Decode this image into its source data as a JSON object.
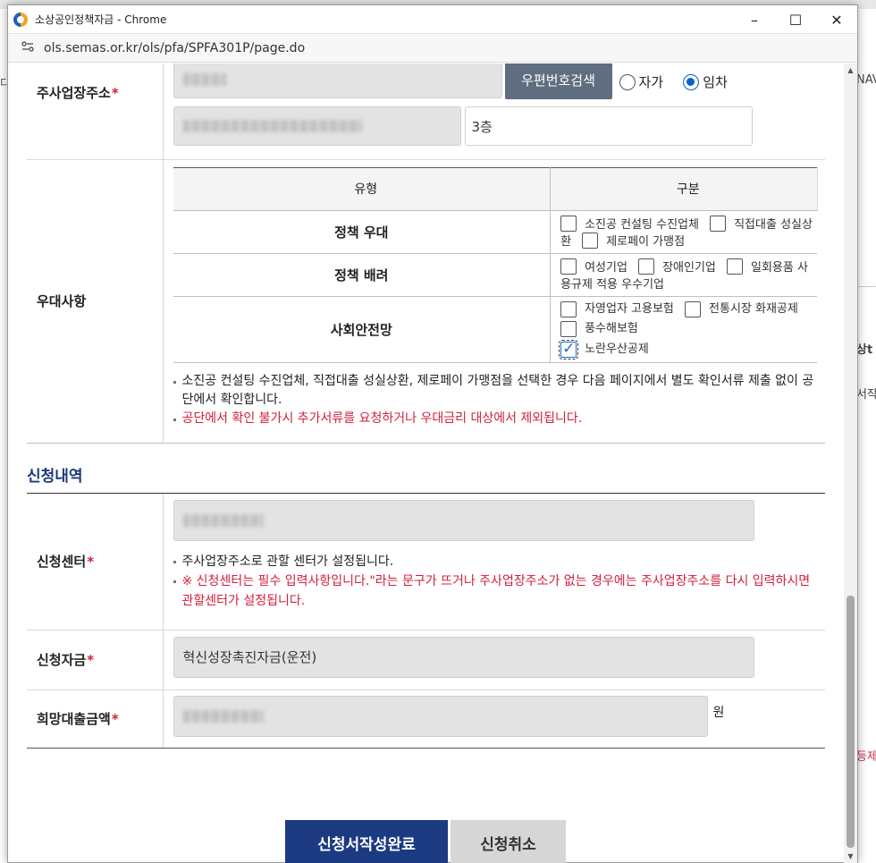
{
  "window": {
    "title": "소상공인정책자금 - Chrome",
    "url": "ols.semas.or.kr/ols/pfa/SPFA301P/page.do",
    "controls": {
      "minimize": "–",
      "maximize": "☐",
      "close": "✕"
    }
  },
  "background": {
    "left_text": "디",
    "right_texts": [
      "NAV",
      "상t",
      "서작",
      "등제"
    ]
  },
  "address": {
    "label": "주사업장주소",
    "required_mark": "*",
    "search_button": "우편번호검색",
    "ownership_options": [
      {
        "label": "자가",
        "selected": false
      },
      {
        "label": "임차",
        "selected": true
      }
    ],
    "detail_value": "3층"
  },
  "preferences": {
    "label": "우대사항",
    "header_type": "유형",
    "header_category": "구분",
    "rows": [
      {
        "name": "정책 우대",
        "options": [
          {
            "label": "소진공 컨설팅 수진업체",
            "checked": false
          },
          {
            "label": "직접대출 성실상환",
            "checked": false
          },
          {
            "label": "제로페이 가맹점",
            "checked": false
          }
        ]
      },
      {
        "name": "정책 배려",
        "options": [
          {
            "label": "여성기업",
            "checked": false
          },
          {
            "label": "장애인기업",
            "checked": false
          },
          {
            "label": "일회용품 사용규제 적용 우수기업",
            "checked": false
          }
        ]
      },
      {
        "name": "사회안전망",
        "options": [
          {
            "label": "자영업자 고용보험",
            "checked": false
          },
          {
            "label": "전통시장 화재공제",
            "checked": false
          },
          {
            "label": "풍수해보험",
            "checked": false
          },
          {
            "label": "노란우산공제",
            "checked": true
          }
        ]
      }
    ],
    "note": "소진공 컨설팅 수진업체, 직접대출 성실상환, 제로페이 가맹점을 선택한 경우 다음 페이지에서 별도 확인서류 제출 없이 공단에서 확인합니다.",
    "warning": "공단에서 확인 불가시 추가서류를 요청하거나 우대금리 대상에서 제외됩니다."
  },
  "application": {
    "section_title": "신청내역",
    "center_label": "신청센터",
    "center_note": "주사업장주소로 관할 센터가 설정됩니다.",
    "center_warning": "※ 신청센터는 필수 입력사항입니다.\"라는 문구가 뜨거나 주사업장주소가 없는 경우에는 주사업장주소를 다시 입력하시면 관할센터가 설정됩니다.",
    "fund_label": "신청자금",
    "fund_value": "혁신성장촉진자금(운전)",
    "amount_label": "희망대출금액",
    "amount_unit": "원",
    "required_mark": "*"
  },
  "buttons": {
    "submit": "신청서작성완료",
    "cancel": "신청취소"
  },
  "colors": {
    "primary": "#1b3a82",
    "required": "#d21f3c",
    "search_button": "#5f6e80",
    "checkbox_checked": "#1a66d0"
  }
}
